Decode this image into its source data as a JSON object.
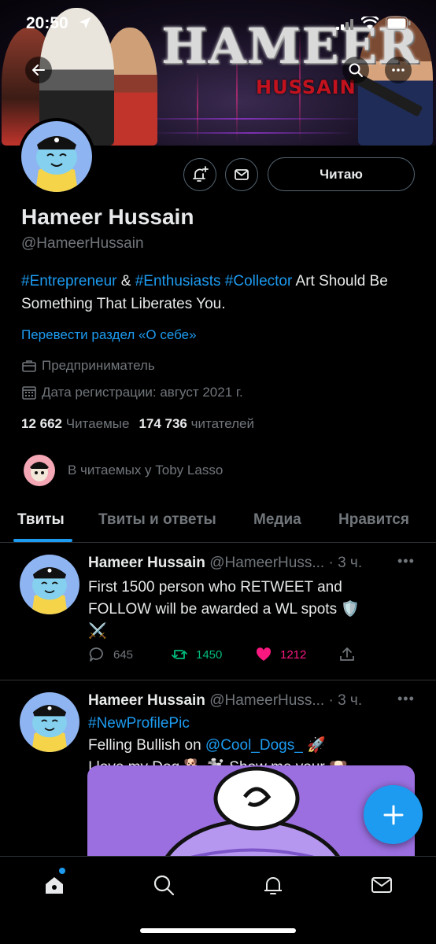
{
  "status_bar": {
    "time": "20:50"
  },
  "banner": {
    "title": "HAMEER",
    "subtitle": "HUSSAIN"
  },
  "profile": {
    "name": "Hameer Hussain",
    "handle": "@HameerHussain",
    "follow_button": "Читаю",
    "bio": {
      "tag1": "#Entrepreneur",
      "amp": " & ",
      "tag2": "#Enthusiasts",
      "space": " ",
      "tag3": "#Collector",
      "rest": " Art Should Be Something That Liberates You."
    },
    "translate_link": "Перевести раздел «О себе»",
    "job": "Предприниматель",
    "joined": "Дата регистрации: август 2021 г.",
    "following_count": "12 662",
    "following_label": "Читаемые",
    "followers_count": "174 736",
    "followers_label": "читателей",
    "followed_by": "В читаемых у Toby Lasso"
  },
  "tabs": [
    "Твиты",
    "Твиты и ответы",
    "Медиа",
    "Нравится"
  ],
  "tweets": [
    {
      "name": "Hameer Hussain",
      "handle": "@HameerHuss...",
      "time": "· 3 ч.",
      "more": "•••",
      "line1": "First 1500 person who RETWEET and",
      "line2": "FOLLOW will be awarded a WL spots 🛡️",
      "line3": "⚔️",
      "replies": "645",
      "retweets": "1450",
      "likes": "1212"
    },
    {
      "name": "Hameer Hussain",
      "handle": "@HameerHuss...",
      "time": "· 3 ч.",
      "more": "•••",
      "hashtag": "#NewProfilePic",
      "line2_prefix": "Felling Bullish on ",
      "mention": "@Cool_Dogs_",
      "line2_suffix": " 🚀",
      "line3": "I love my Dog 🐕 🐩 Show me your 🐶"
    }
  ],
  "icons": {
    "back": "back-arrow-icon",
    "search": "search-icon",
    "more": "more-icon",
    "notifications": "bell-plus-icon",
    "message": "mail-icon",
    "compose": "plus-icon",
    "nav": [
      "home-icon",
      "search-icon",
      "bell-icon",
      "mail-icon"
    ]
  },
  "colors": {
    "accent": "#1d9bf0",
    "retweet": "#00ba7c",
    "like": "#f91880",
    "muted": "#71767b"
  }
}
